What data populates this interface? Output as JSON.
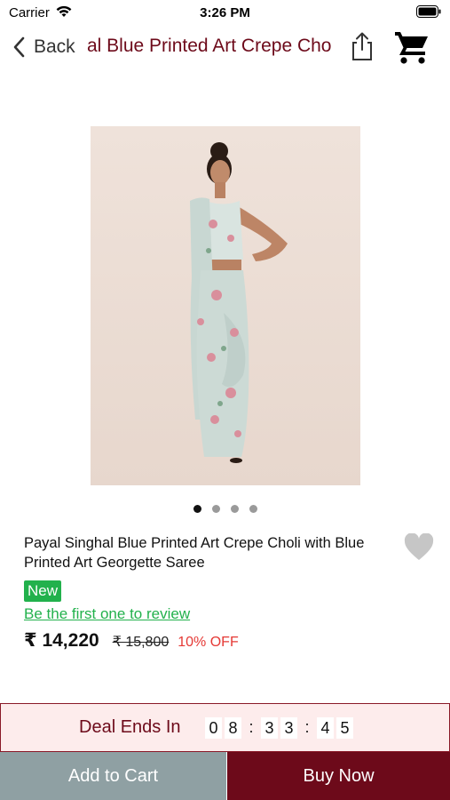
{
  "status_bar": {
    "carrier": "Carrier",
    "time": "3:26 PM",
    "icons": [
      "wifi-icon",
      "battery-icon"
    ]
  },
  "nav": {
    "back_label": "Back",
    "title": "Payal Singhal Blue Printed Art Crepe Choli with Blue Printed Art Georgette Saree",
    "visible_title": "al Blue Printed Art Crepe Cho",
    "icons": [
      "chevron-left-icon",
      "share-icon",
      "cart-icon"
    ]
  },
  "product": {
    "image_icon": "product-photo",
    "carousel": {
      "count": 4,
      "active_index": 1
    },
    "title": "Payal Singhal Blue Printed Art Crepe Choli with Blue Printed Art Georgette Saree",
    "badge": "New",
    "review_link": "Be the first one to review",
    "price": "₹ 14,220",
    "original_price": "₹ 15,800",
    "discount": "10% OFF",
    "wishlist_icon": "heart-icon"
  },
  "deal": {
    "label": "Deal Ends In",
    "timer": [
      "0",
      "8",
      ":",
      "3",
      "3",
      ":",
      "4",
      "5"
    ]
  },
  "actions": {
    "add_to_cart": "Add to Cart",
    "buy_now": "Buy Now"
  },
  "colors": {
    "brand": "#6d0a1a",
    "green": "#22b14c",
    "discount_red": "#e53935",
    "add_to_cart_bg": "#8fa0a3",
    "deal_bg": "#fdecec"
  }
}
